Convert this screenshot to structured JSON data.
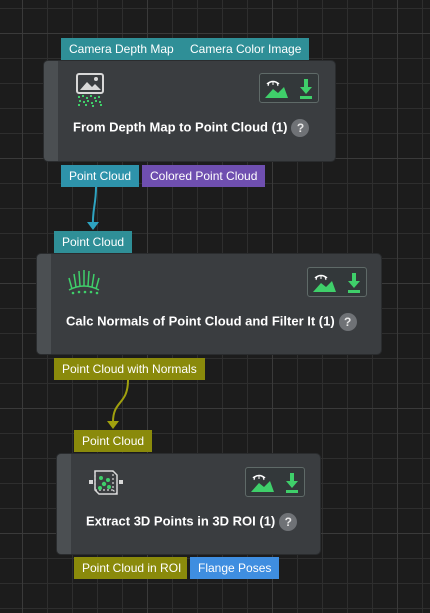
{
  "colors": {
    "teal_port": "#2f8f97",
    "cyan_port": "#2e93ab",
    "purple_port": "#6f4fb0",
    "olive_port": "#8a8a0b",
    "blue_port": "#3f8ee0",
    "node_bg": "#3a3d40",
    "accent_green": "#3fcf6a"
  },
  "nodes": [
    {
      "title": "From Depth Map to Point Cloud (1)",
      "help": "?",
      "icon": "depth-map-icon",
      "inputs": [
        "Camera Depth Map",
        "Camera Color Image"
      ],
      "outputs": [
        "Point Cloud",
        "Colored Point Cloud"
      ],
      "tools": [
        "visualize-icon",
        "save-output-icon"
      ]
    },
    {
      "title": "Calc Normals of Point Cloud and Filter It (1)",
      "help": "?",
      "icon": "normals-icon",
      "inputs": [
        "Point Cloud"
      ],
      "outputs": [
        "Point Cloud with Normals"
      ],
      "tools": [
        "visualize-icon",
        "save-output-icon"
      ]
    },
    {
      "title": "Extract 3D Points in 3D ROI (1)",
      "help": "?",
      "icon": "roi-cube-icon",
      "inputs": [
        "Point Cloud"
      ],
      "outputs": [
        "Point Cloud in ROI",
        "Flange Poses"
      ],
      "tools": [
        "visualize-icon",
        "save-output-icon"
      ]
    }
  ]
}
